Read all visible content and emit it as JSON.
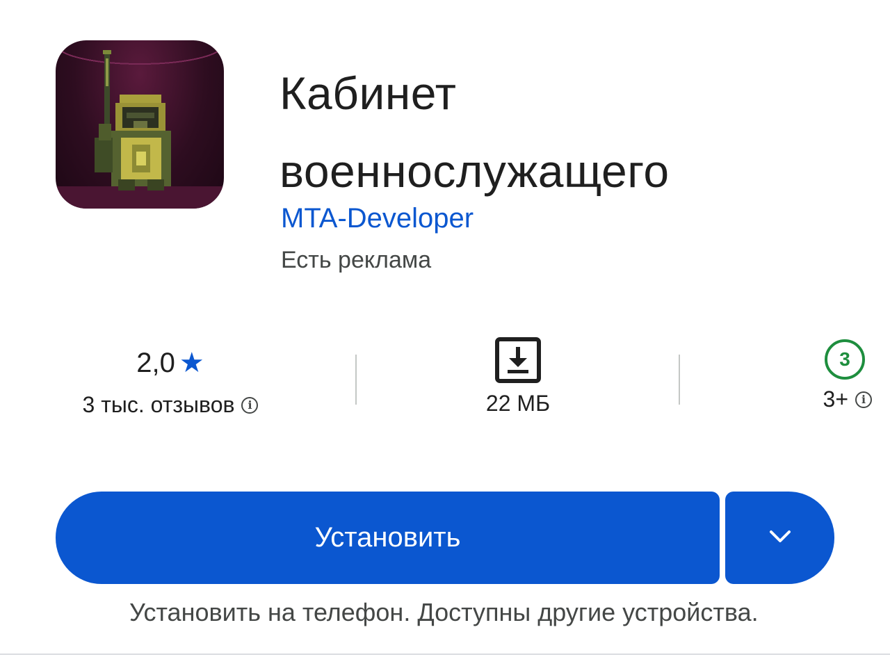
{
  "app": {
    "title_line1": "Кабинет",
    "title_line2": "военнослужащего",
    "developer": "MTA-Developer",
    "ads_notice": "Есть реклама"
  },
  "stats": {
    "rating_value": "2,0",
    "rating_icon": "star-icon",
    "reviews_label": "3 тыс. отзывов",
    "size_icon": "download-icon",
    "size_label": "22 МБ",
    "age_badge": "3",
    "age_label": "3+",
    "info_glyph": "i"
  },
  "install": {
    "button_label": "Установить",
    "more_icon": "chevron-down-icon",
    "hint": "Установить на телефон. Доступны другие устройства."
  },
  "colors": {
    "accent": "#0b57d0",
    "age_green": "#1e8e3e",
    "text_primary": "#1f1f1f",
    "text_secondary": "#444746"
  }
}
